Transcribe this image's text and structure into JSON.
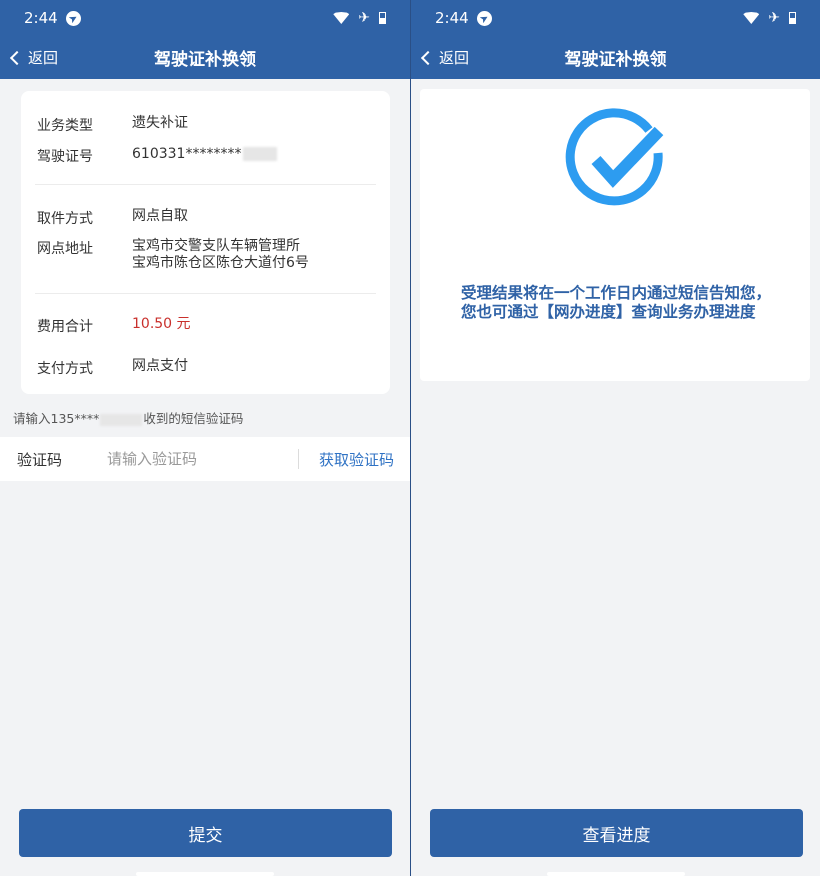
{
  "status": {
    "time": "2:44"
  },
  "left": {
    "nav": {
      "back_label": "返回",
      "title": "驾驶证补换领"
    },
    "details": [
      {
        "label": "业务类型",
        "value": "遗失补证"
      },
      {
        "label": "驾驶证号",
        "value": "610331********"
      },
      {
        "label": "取件方式",
        "value": "网点自取"
      },
      {
        "label": "网点地址",
        "value_line1": "宝鸡市交警支队车辆管理所",
        "value_line2": "宝鸡市陈仓区陈仓大道付6号"
      },
      {
        "label": "费用合计",
        "value": "10.50 元"
      },
      {
        "label": "支付方式",
        "value": "网点支付"
      }
    ],
    "sms_hint_prefix": "请输入135****",
    "sms_hint_suffix": "收到的短信验证码",
    "code": {
      "label": "验证码",
      "placeholder": "请输入验证码",
      "get_code_label": "获取验证码"
    },
    "submit_label": "提交"
  },
  "right": {
    "nav": {
      "back_label": "返回",
      "title": "驾驶证补换领"
    },
    "message": "受理结果将在一个工作日内通过短信告知您，您也可通过【网办进度】查询业务办理进度",
    "view_progress_label": "查看进度",
    "accent": "#2f62a6",
    "check_color": "#2d9cf0"
  }
}
